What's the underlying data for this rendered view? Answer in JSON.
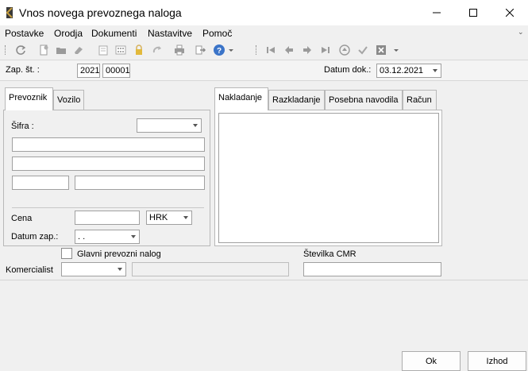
{
  "window": {
    "title": "Vnos novega prevoznega naloga"
  },
  "menu": {
    "items": [
      "Postavke",
      "Orodja",
      "Dokumenti",
      "Nastavitve",
      "Pomoč"
    ]
  },
  "toolbar": {
    "icons": [
      "refresh-icon",
      "new-doc-icon",
      "open-folder-icon",
      "eraser-icon",
      "calculator-icon",
      "lock-icon",
      "redo-icon",
      "print-icon",
      "export-icon",
      "help-icon",
      "first-icon",
      "prev-icon",
      "next-icon",
      "last-icon",
      "eject-icon",
      "confirm-icon",
      "cancel-icon"
    ]
  },
  "header": {
    "zap_label": "Zap. št. :",
    "year_value": "2021",
    "number_value": "00001",
    "datum_label": "Datum dok.:",
    "datum_value": "03.12.2021"
  },
  "left_tabs": [
    "Prevoznik",
    "Vozilo"
  ],
  "prevoznik": {
    "sifra_label": "Šifra :",
    "sifra_value": "",
    "cena_label": "Cena",
    "cena_value": "",
    "currency_value": "HRK",
    "datum_zap_label": "Datum zap.:",
    "datum_zap_value": ". ."
  },
  "right_tabs": [
    "Nakladanje",
    "Razkladanje",
    "Posebna navodila",
    "Račun"
  ],
  "bottom": {
    "glavni_label": "Glavni prevozni nalog",
    "stevilka_cmr_label": "Številka CMR",
    "komercialist_label": "Komercialist"
  },
  "buttons": {
    "ok": "Ok",
    "izhod": "Izhod"
  }
}
